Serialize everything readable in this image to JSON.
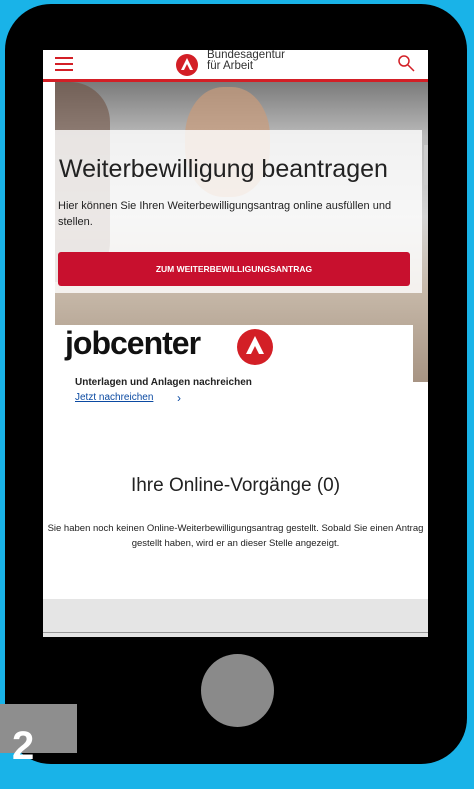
{
  "header": {
    "brand_line1": "Bundesagentur",
    "brand_line2": "für Arbeit",
    "accent_color": "#d31f26"
  },
  "hero": {
    "title": "Weiterbewilligung beantragen",
    "intro": "Hier können Sie Ihren Weiterbewilligungsantrag online ausfüllen und stellen.",
    "cta_label": "ZUM WEITERBEWILLIGUNGSANTRAG"
  },
  "jobcenter": {
    "logo_text": "jobcenter",
    "title": "Unterlagen und Anlagen nachreichen",
    "link_label": "Jetzt nachreichen"
  },
  "procedures": {
    "title": "Ihre Online-Vorgänge (0)",
    "note": "Sie haben noch keinen Online-Weiterbewilligungsantrag gestellt. Sobald Sie einen Antrag gestellt haben, wird er an dieser Stelle angezeigt."
  },
  "step_badge": "2",
  "icons": [
    "menu-icon",
    "ba-logo-icon",
    "search-icon",
    "jobcenter-logo-icon",
    "chevron-right-icon"
  ]
}
